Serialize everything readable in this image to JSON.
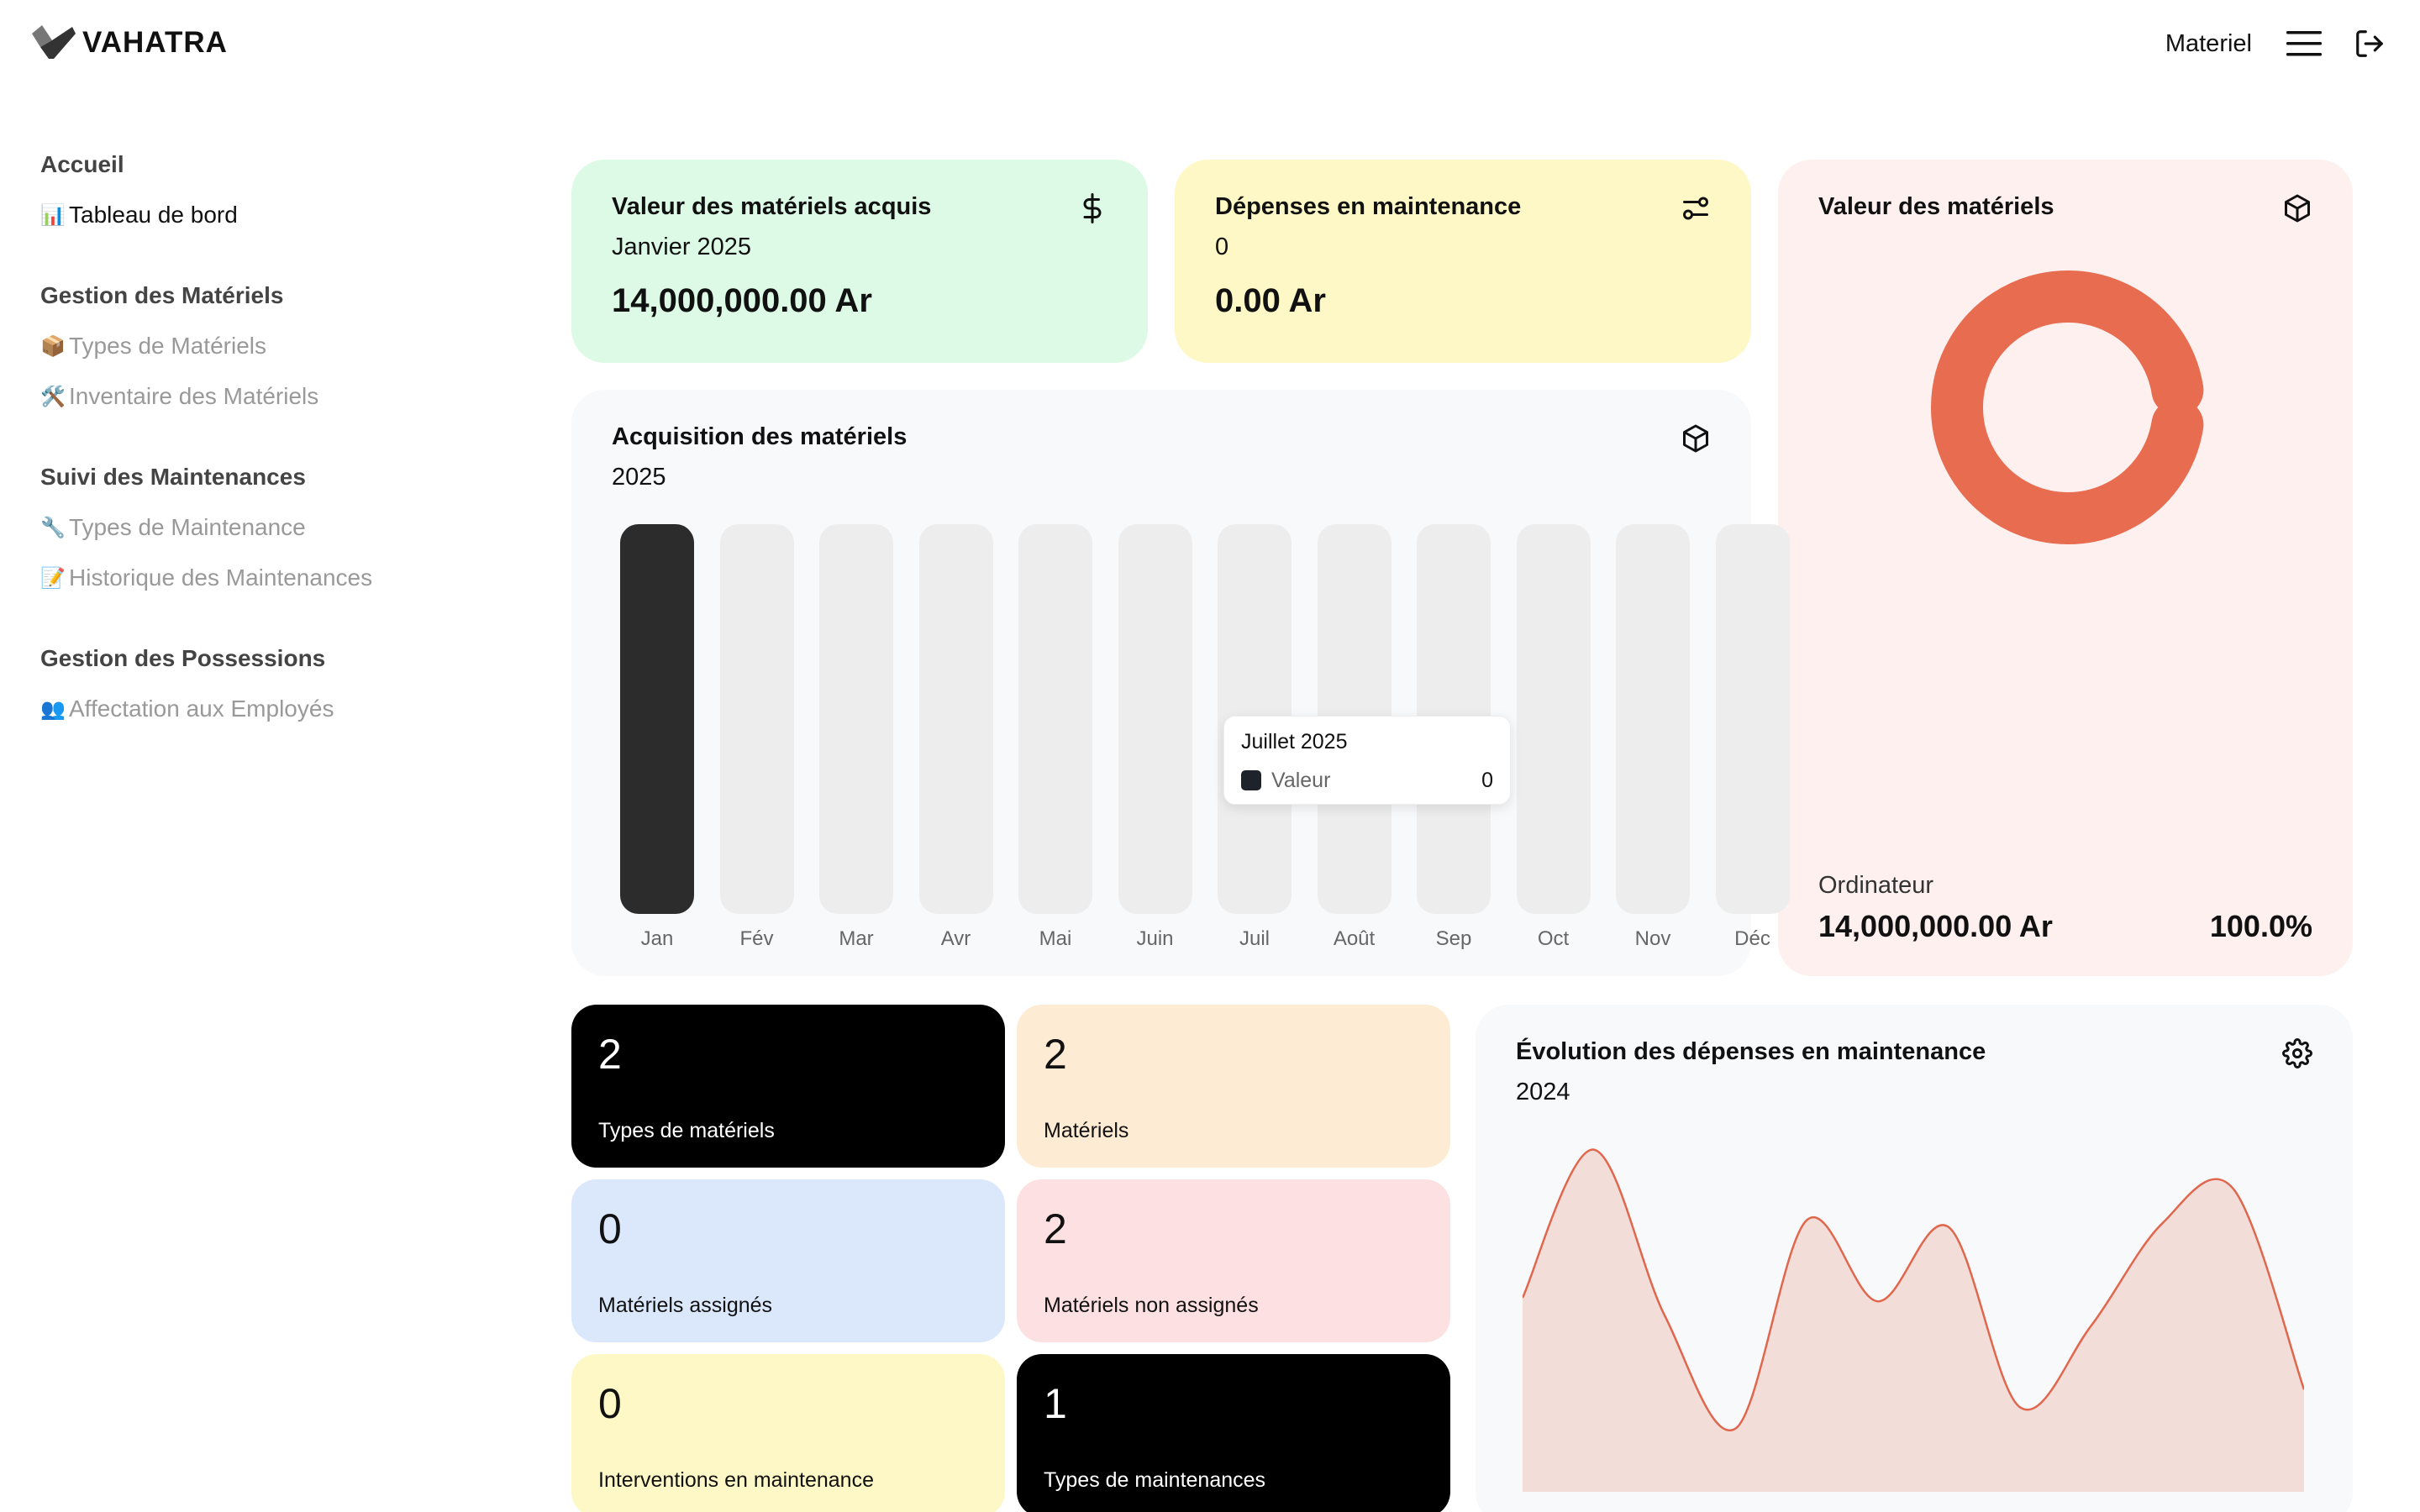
{
  "app": {
    "name": "VAHATRA"
  },
  "header": {
    "user_label": "Materiel",
    "menu_icon": "hamburger-icon",
    "logout_icon": "logout-icon"
  },
  "sidebar": {
    "groups": [
      {
        "title": "Accueil",
        "items": [
          {
            "icon": "📊",
            "label": "Tableau de bord",
            "active": true
          }
        ]
      },
      {
        "title": "Gestion des Matériels",
        "items": [
          {
            "icon": "📦",
            "label": "Types de Matériels"
          },
          {
            "icon": "🛠️",
            "label": "Inventaire des Matériels"
          }
        ]
      },
      {
        "title": "Suivi des Maintenances",
        "items": [
          {
            "icon": "🔧",
            "label": "Types de Maintenance"
          },
          {
            "icon": "📝",
            "label": "Historique des Maintenances"
          }
        ]
      },
      {
        "title": "Gestion des Possessions",
        "items": [
          {
            "icon": "👥",
            "label": "Affectation aux Employés"
          }
        ]
      }
    ]
  },
  "cards": {
    "acquired": {
      "title": "Valeur des matériels acquis",
      "subtitle": "Janvier 2025",
      "value": "14,000,000.00 Ar",
      "icon": "dollar-icon"
    },
    "maintenance": {
      "title": "Dépenses en maintenance",
      "subtitle": "0",
      "value": "0.00 Ar",
      "icon": "sliders-icon"
    },
    "value": {
      "title": "Valeur des matériels",
      "icon": "box-icon",
      "category": "Ordinateur",
      "amount": "14,000,000.00 Ar",
      "percent": "100.0%",
      "color": "#e76c50"
    },
    "acq_chart": {
      "title": "Acquisition des matériels",
      "subtitle": "2025",
      "icon": "box-icon"
    },
    "evolution": {
      "title": "Évolution des dépenses en maintenance",
      "subtitle": "2024",
      "icon": "gear-icon"
    }
  },
  "tooltip": {
    "title": "Juillet 2025",
    "series": "Valeur",
    "value": "0"
  },
  "tiles": [
    {
      "num": "2",
      "label": "Types de matériels",
      "bg": "#000000",
      "dark": true
    },
    {
      "num": "2",
      "label": "Matériels",
      "bg": "#fdebd3",
      "dark": false
    },
    {
      "num": "0",
      "label": "Matériels assignés",
      "bg": "#dbe8fc",
      "dark": false
    },
    {
      "num": "2",
      "label": "Matériels non assignés",
      "bg": "#fde1e2",
      "dark": false
    },
    {
      "num": "0",
      "label": "Interventions en maintenance",
      "bg": "#fef8c6",
      "dark": false
    },
    {
      "num": "1",
      "label": "Types de maintenances",
      "bg": "#000000",
      "dark": true
    }
  ],
  "chart_data": [
    {
      "type": "bar",
      "title": "Acquisition des matériels",
      "categories": [
        "Jan",
        "Fév",
        "Mar",
        "Avr",
        "Mai",
        "Juin",
        "Juil",
        "Août",
        "Sep",
        "Oct",
        "Nov",
        "Déc"
      ],
      "series": [
        {
          "name": "Valeur",
          "values": [
            14000000,
            0,
            0,
            0,
            0,
            0,
            0,
            0,
            0,
            0,
            0,
            0
          ]
        }
      ],
      "ylim": [
        0,
        14000000
      ],
      "colors": {
        "bar": "#2c2c2c",
        "track": "#ededed"
      }
    },
    {
      "type": "pie",
      "title": "Valeur des matériels",
      "labels": [
        "Ordinateur"
      ],
      "values": [
        100.0
      ]
    },
    {
      "type": "area",
      "title": "Évolution des dépenses en maintenance",
      "x": [
        1,
        2,
        3,
        4,
        5,
        6,
        7,
        8,
        9,
        10,
        11,
        12
      ],
      "values": [
        55,
        97,
        50,
        18,
        77,
        54,
        75,
        24,
        47,
        76,
        86,
        29
      ],
      "ylim": [
        0,
        100
      ],
      "colors": {
        "line": "#e0674d",
        "fill": "#f2ddd8"
      }
    }
  ]
}
